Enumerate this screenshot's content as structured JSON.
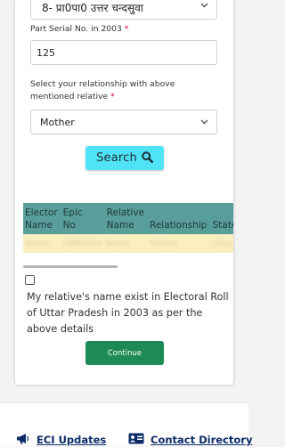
{
  "form": {
    "assembly_select_value": "8- प्रा0पा0 उत्तर चन्दसुवा",
    "serial_label": "Part Serial No. in 2003",
    "required_mark": "*",
    "serial_value": "125",
    "relationship_label_line1": "Select your relationship with above",
    "relationship_label_line2": "mentioned relative",
    "relationship_value": "Mother",
    "search_label": "Search"
  },
  "table": {
    "headers": [
      [
        "Elector",
        "Name"
      ],
      [
        "Epic",
        "No"
      ],
      [
        "Relative",
        "Name"
      ],
      [
        "Relationship"
      ],
      [
        "State"
      ]
    ],
    "row_redacted": [
      "Name",
      "ABM0000",
      "Name",
      "Mother",
      "Uttar"
    ]
  },
  "consent": {
    "text": "My relative's name exist in Electoral Roll of Uttar Pradesh in 2003 as per the above details"
  },
  "continue_label": "Continue",
  "footer": {
    "eci_updates": "ECI Updates",
    "contact_directory": "Contact Directory"
  }
}
